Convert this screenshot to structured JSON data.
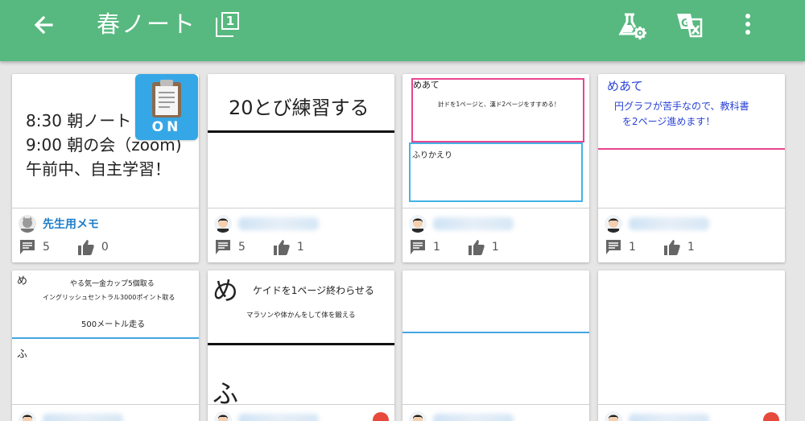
{
  "appbar": {
    "title": "春ノート",
    "page_count": "1",
    "color": "#57b97f",
    "icons": [
      "arrow-back-icon",
      "copy-page-icon",
      "flask-settings-icon",
      "translate-off-icon",
      "more-vert-icon"
    ]
  },
  "badge": {
    "label": "ON",
    "icon": "clipboard-icon",
    "color": "#36a7e6"
  },
  "cards": [
    {
      "lines": [
        "8:30 朝ノート",
        "9:00 朝の会（zoom)",
        "午前中、自主学習！"
      ],
      "author": "先生用メモ",
      "comments": "5",
      "likes": "0"
    },
    {
      "title": "20とび練習する",
      "author": "",
      "comments": "5",
      "likes": "1"
    },
    {
      "goal_label": "めあて",
      "goal_text": "計ドを1ページと、漢ド2ページをすすめる！",
      "review_label": "ふりかえり",
      "author": "",
      "comments": "1",
      "likes": "1"
    },
    {
      "goal_label": "めあて",
      "goal_line1": "円グラフが苦手なので、教科書",
      "goal_line2": "を2ページ進めます！",
      "author": "",
      "comments": "1",
      "likes": "1"
    },
    {
      "top_label": "め",
      "line1": "やる気一金カップ5個取る",
      "line2": "イングリッシュセントラル3000ポイント取る",
      "line3": "500メートル走る",
      "bottom_label": "ふ"
    },
    {
      "top_label": "め",
      "line1": "ケイドを1ページ終わらせる",
      "line2": "マラソンや体かんをして体を鍛える",
      "bottom_label": "ふ"
    },
    {},
    {}
  ],
  "colors": {
    "author_link": "#1f7ec9",
    "pink_box": "#e8458f",
    "blue_box": "#44b3e6",
    "blue_text": "#2a43d6",
    "red_line": "#e8458f",
    "x_badge": "#e64a3c"
  }
}
